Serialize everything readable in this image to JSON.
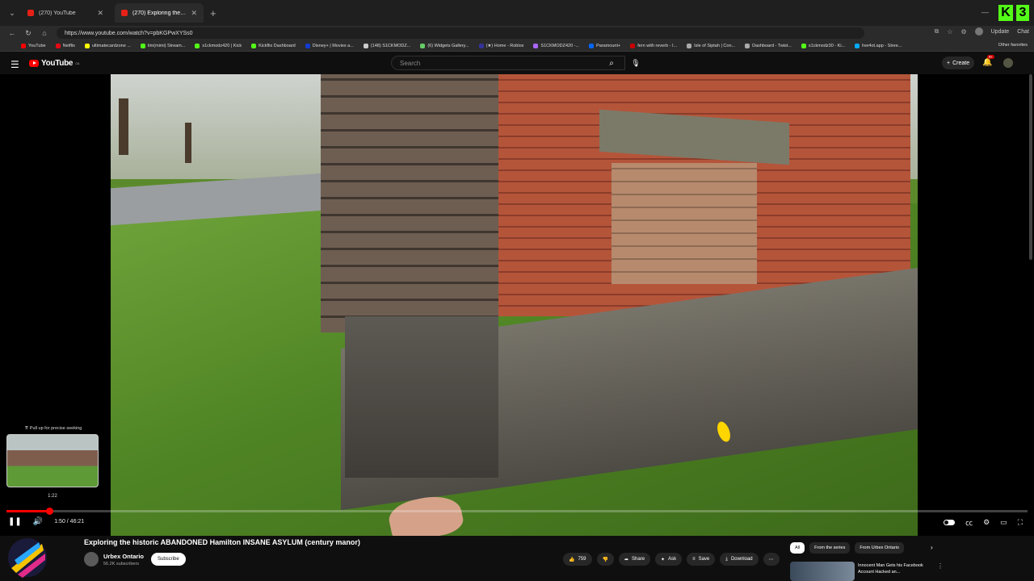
{
  "browser": {
    "tabs": [
      {
        "label": "(270) YouTube"
      },
      {
        "label": "(270) Exploring the historic A"
      }
    ],
    "url": "https://www.youtube.com/watch?v=pbKGPwXYSs0",
    "update_label": "Update",
    "chat_label": "Chat",
    "bookmarks": [
      "YouTube",
      "Netflix",
      "ultimatecardzone ...",
      "tim(mimi) Stream...",
      "s1ckmodz420 | Kick",
      "Kickflix Dashboard",
      "Disney+ | Movies a...",
      "(148) S1CKMODZ...",
      "(6) Widgets Gallery...",
      "(★) Home - Roblox",
      "S1CKMODZ420 -...",
      "Paramount+",
      "fern with reverb - I...",
      "Isle of Siptah | Con...",
      "Dashboard - Twist...",
      "s1ckmodz30 - Ki...",
      "live4ot.app - Stree..."
    ],
    "other_favorites": "Other favorites"
  },
  "youtube": {
    "logo_text": "YouTube",
    "logo_sup": "CA",
    "search_placeholder": "Search",
    "create_label": "Create",
    "notif_badge": "9+"
  },
  "player": {
    "seek_hint": "⇈ Pull up for precise seeking",
    "seek_time": "1:22",
    "progress": 0.042,
    "current_time": "1:50",
    "duration": "46:21",
    "time_display": "1:50 / 46:21"
  },
  "video": {
    "title": "Exploring the historic ABANDONED Hamilton INSANE ASYLUM (century manor)",
    "channel": "Urbex Ontario",
    "subscribers": "56.2K subscribers",
    "subscribe_label": "Subscribe",
    "likes": "759",
    "share_label": "Share",
    "ask_label": "Ask",
    "save_label": "Save",
    "download_label": "Download"
  },
  "recommendations": {
    "chips": [
      "All",
      "From the series",
      "From Urbex Ontario"
    ],
    "first_title": "Innocent Man Gets his Facebook Account Hacked an..."
  },
  "colors": {
    "accent": "#ff0000",
    "background": "#0f0f0f",
    "kick_green": "#53fc18"
  }
}
